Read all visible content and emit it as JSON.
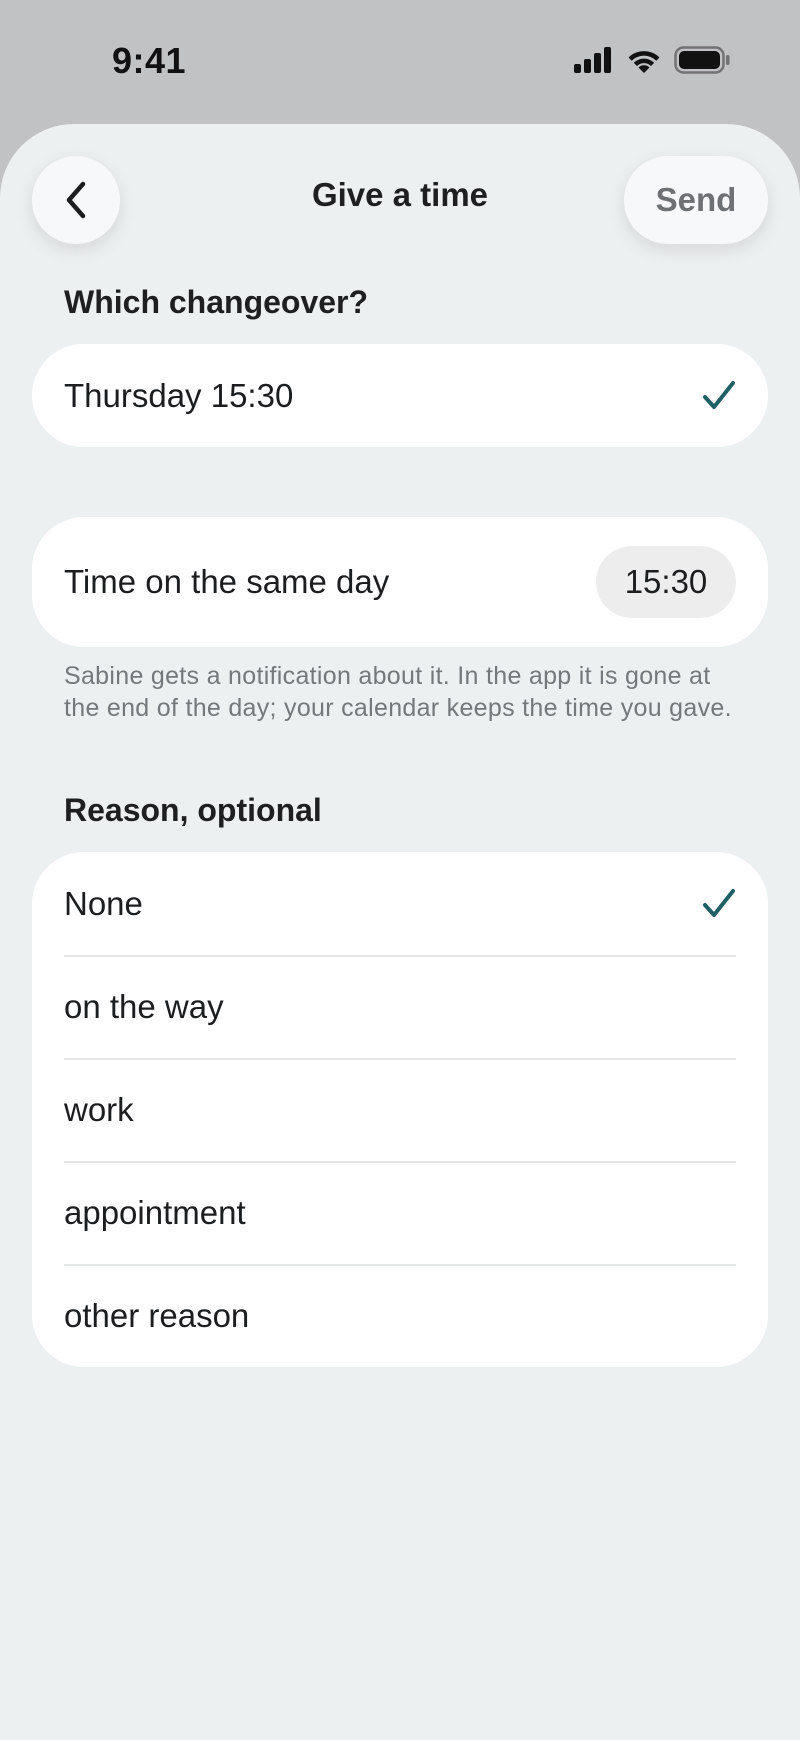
{
  "status_bar": {
    "time": "9:41"
  },
  "nav": {
    "title": "Give a time",
    "send_label": "Send"
  },
  "changeover": {
    "heading": "Which changeover?",
    "selected": "Thursday 15:30"
  },
  "time_setting": {
    "label": "Time on the same day",
    "value": "15:30",
    "note": "Sabine gets a notification about it. In the app it is gone at the end of the day; your calendar keeps the time you gave."
  },
  "reason": {
    "heading": "Reason, optional",
    "options": [
      {
        "label": "None",
        "selected": true
      },
      {
        "label": "on the way",
        "selected": false
      },
      {
        "label": "work",
        "selected": false
      },
      {
        "label": "appointment",
        "selected": false
      },
      {
        "label": "other reason",
        "selected": false
      }
    ]
  },
  "colors": {
    "accent": "#1f5f66",
    "sheet_bg": "#edf0f1",
    "card_bg": "#ffffff"
  }
}
